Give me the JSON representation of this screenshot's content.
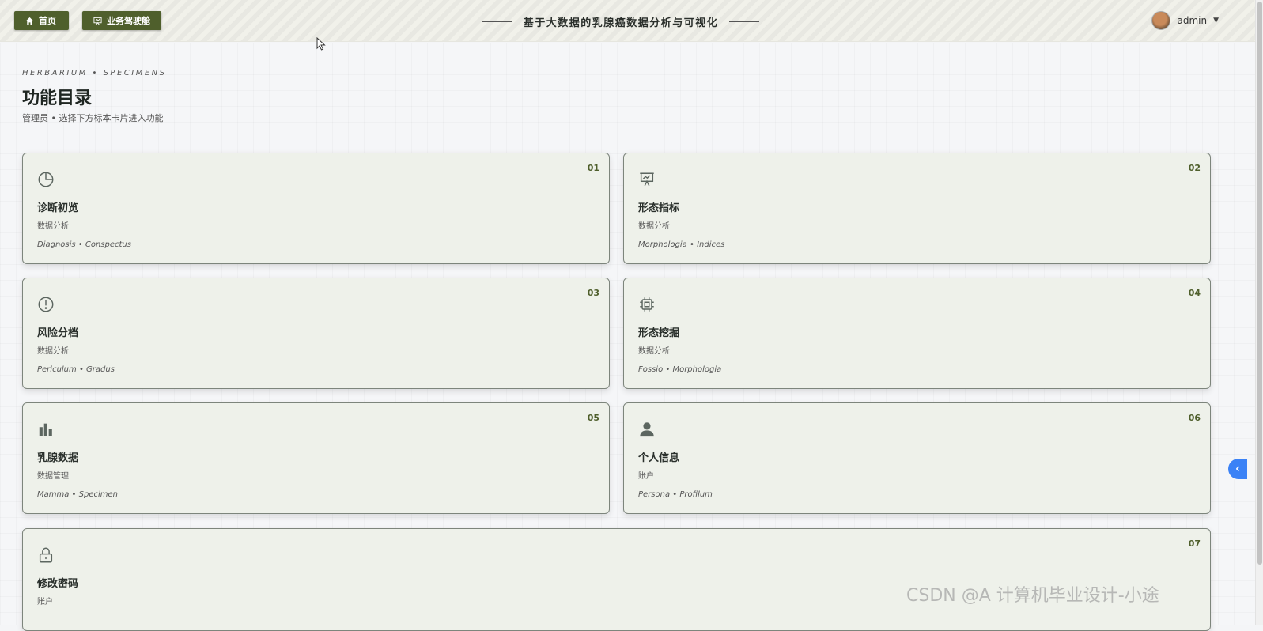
{
  "header": {
    "home_label": "首页",
    "cockpit_label": "业务驾驶舱",
    "title": "基于大数据的乳腺癌数据分析与可视化",
    "user_name": "admin"
  },
  "page": {
    "overline": "HERBARIUM  •  SPECIMENS",
    "title": "功能目录",
    "subtitle": "管理员 • 选择下方标本卡片进入功能"
  },
  "cards": [
    {
      "num": "01",
      "icon": "pie-chart-icon",
      "title": "诊断初览",
      "category": "数据分析",
      "latin": "Diagnosis • Conspectus"
    },
    {
      "num": "02",
      "icon": "presentation-chart-icon",
      "title": "形态指标",
      "category": "数据分析",
      "latin": "Morphologia • Indices"
    },
    {
      "num": "03",
      "icon": "alert-circle-icon",
      "title": "风险分档",
      "category": "数据分析",
      "latin": "Periculum • Gradus"
    },
    {
      "num": "04",
      "icon": "cpu-chip-icon",
      "title": "形态挖掘",
      "category": "数据分析",
      "latin": "Fossio • Morphologia"
    },
    {
      "num": "05",
      "icon": "bar-chart-icon",
      "title": "乳腺数据",
      "category": "数据管理",
      "latin": "Mamma • Specimen"
    },
    {
      "num": "06",
      "icon": "user-icon",
      "title": "个人信息",
      "category": "账户",
      "latin": "Persona • Profilum"
    },
    {
      "num": "07",
      "icon": "lock-icon",
      "title": "修改密码",
      "category": "账户",
      "latin": ""
    }
  ],
  "watermark": "CSDN @A 计算机毕业设计-小途"
}
